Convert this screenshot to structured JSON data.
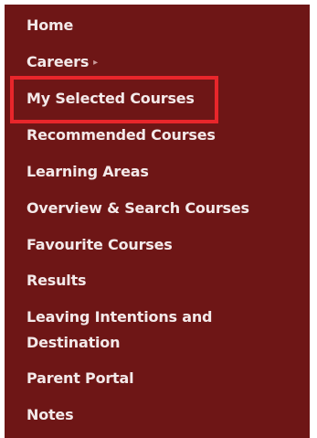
{
  "nav": {
    "items": [
      {
        "label": "Home"
      },
      {
        "label": "Careers",
        "icon": "chevron-right-icon"
      },
      {
        "label": "My Selected Courses",
        "highlighted": true
      },
      {
        "label": "Recommended Courses"
      },
      {
        "label": "Learning Areas"
      },
      {
        "label": "Overview & Search Courses"
      },
      {
        "label": "Favourite Courses"
      },
      {
        "label": "Results"
      },
      {
        "label": "Leaving Intentions and Destination"
      },
      {
        "label": "Parent Portal"
      },
      {
        "label": "Notes"
      }
    ],
    "chevron_glyph": "▸"
  },
  "colors": {
    "panel_background": "#6e1616",
    "text": "#f3e9e9",
    "highlight_border": "#e8262b"
  }
}
